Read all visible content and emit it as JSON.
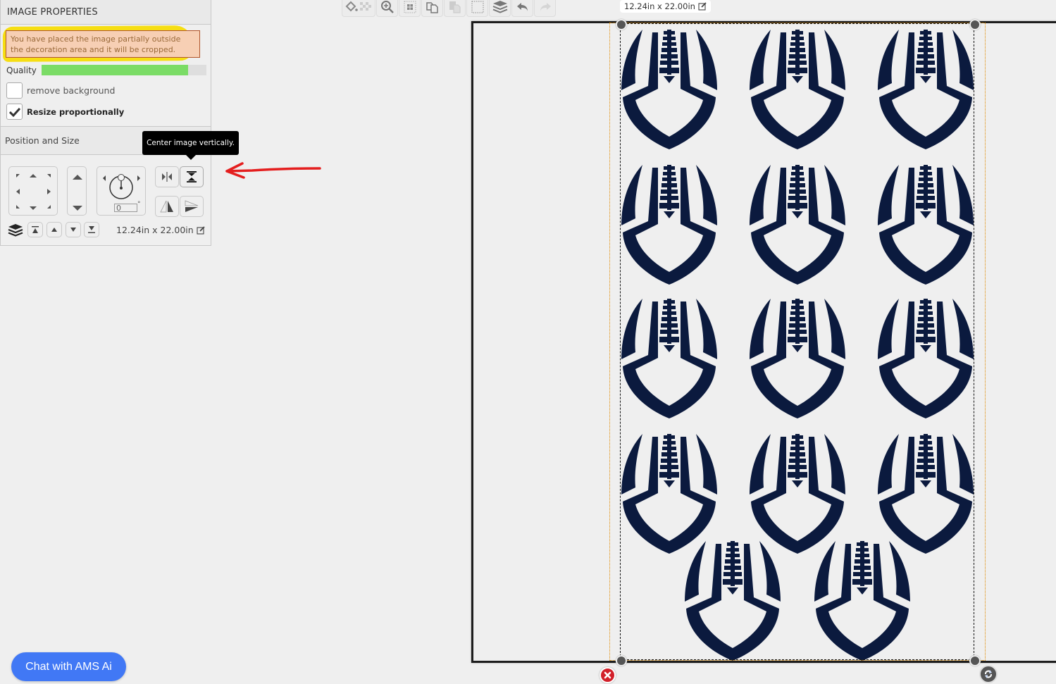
{
  "panel": {
    "title": "IMAGE PROPERTIES",
    "warning": "You have placed the image partially outside the decoration area and it will be cropped.",
    "quality_label": "Quality",
    "quality_percent": 89,
    "remove_background": {
      "label": "remove background",
      "checked": false
    },
    "resize_proportionally": {
      "label": "Resize proportionally",
      "checked": true
    },
    "position_section_title": "Position and Size",
    "rotation_value": "0",
    "rotation_unit": "°",
    "size_readout": "12.24in x 22.00in"
  },
  "tooltip": "Center image vertically.",
  "toolbar": {
    "buttons": [
      "fill-color",
      "transparency",
      "zoom",
      "align-grid",
      "duplicate",
      "paste",
      "select-area",
      "layers",
      "undo",
      "redo"
    ]
  },
  "canvas": {
    "dims_label": "12.24in x 22.00in",
    "design": "football logo pattern",
    "design_color": "#0b1a3e",
    "rows": [
      3,
      3,
      3,
      3,
      2
    ]
  },
  "chat_button": "Chat with AMS Ai",
  "colors": {
    "warning_bg": "#f7cfb4",
    "highlight": "#f6dc00",
    "quality_fill": "#7bdc66",
    "chat_bg": "#4178f5",
    "annotation_arrow": "#e41e1e"
  }
}
